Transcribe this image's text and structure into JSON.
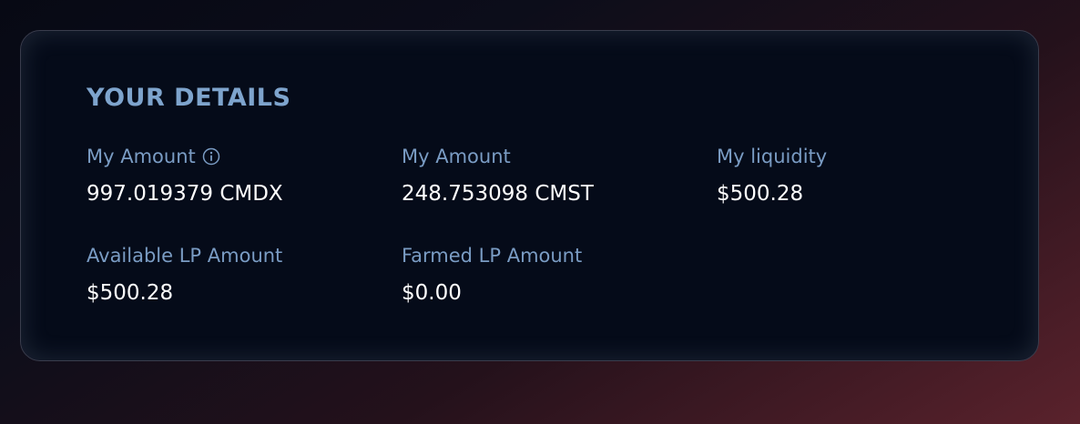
{
  "details": {
    "title": "YOUR DETAILS",
    "fields": [
      {
        "label": "My Amount",
        "value": "997.019379 CMDX",
        "icon": "info-icon"
      },
      {
        "label": "My Amount",
        "value": "248.753098 CMST"
      },
      {
        "label": "My liquidity",
        "value": "$500.28"
      },
      {
        "label": "Available LP Amount",
        "value": "$500.28"
      },
      {
        "label": "Farmed LP Amount",
        "value": "$0.00"
      }
    ]
  },
  "colors": {
    "card_background": "#050b19",
    "title": "#7ea4cd",
    "label": "#7a9cc4",
    "value": "#ffffff"
  }
}
